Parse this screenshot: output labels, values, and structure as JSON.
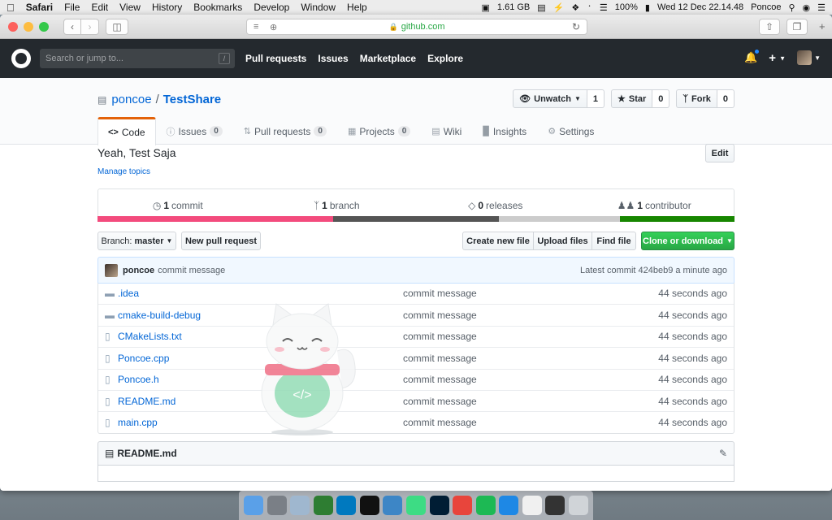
{
  "menubar": {
    "app": "Safari",
    "items": [
      "File",
      "Edit",
      "View",
      "History",
      "Bookmarks",
      "Develop",
      "Window",
      "Help"
    ],
    "memory": "1.61 GB",
    "battery": "100%",
    "datetime": "Wed 12 Dec  22.14.48",
    "user": "Poncoe"
  },
  "browser": {
    "url": "github.com"
  },
  "gh": {
    "search_placeholder": "Search or jump to...",
    "search_key": "/",
    "nav": [
      "Pull requests",
      "Issues",
      "Marketplace",
      "Explore"
    ]
  },
  "repo": {
    "owner": "poncoe",
    "separator": "/",
    "name": "TestShare",
    "watch_label": "Unwatch",
    "watch_count": "1",
    "star_label": "Star",
    "star_count": "0",
    "fork_label": "Fork",
    "fork_count": "0",
    "tabs": [
      {
        "label": "Code",
        "count": null
      },
      {
        "label": "Issues",
        "count": "0"
      },
      {
        "label": "Pull requests",
        "count": "0"
      },
      {
        "label": "Projects",
        "count": "0"
      },
      {
        "label": "Wiki",
        "count": null
      },
      {
        "label": "Insights",
        "count": null
      },
      {
        "label": "Settings",
        "count": null
      }
    ],
    "description": "Yeah, Test Saja",
    "manage_topics": "Manage topics",
    "edit_label": "Edit"
  },
  "summary": {
    "commits_num": "1",
    "commits_label": "commit",
    "branches_num": "1",
    "branches_label": "branch",
    "releases_num": "0",
    "releases_label": "releases",
    "contributors_num": "1",
    "contributors_label": "contributor"
  },
  "langbar_colors": [
    "#f34b7d",
    "#555555",
    "#cccccc",
    "#178600"
  ],
  "actions": {
    "branch_prefix": "Branch:",
    "branch_name": "master",
    "new_pr": "New pull request",
    "create_file": "Create new file",
    "upload": "Upload files",
    "find": "Find file",
    "clone": "Clone or download"
  },
  "commit": {
    "author": "poncoe",
    "message": "commit message",
    "latest": "Latest commit 424beb9 a minute ago"
  },
  "files": [
    {
      "type": "dir",
      "name": ".idea",
      "message": "commit message",
      "age": "44 seconds ago"
    },
    {
      "type": "dir",
      "name": "cmake-build-debug",
      "message": "commit message",
      "age": "44 seconds ago"
    },
    {
      "type": "file",
      "name": "CMakeLists.txt",
      "message": "commit message",
      "age": "44 seconds ago"
    },
    {
      "type": "file",
      "name": "Poncoe.cpp",
      "message": "commit message",
      "age": "44 seconds ago"
    },
    {
      "type": "file",
      "name": "Poncoe.h",
      "message": "commit message",
      "age": "44 seconds ago"
    },
    {
      "type": "file",
      "name": "README.md",
      "message": "commit message",
      "age": "44 seconds ago"
    },
    {
      "type": "file",
      "name": "main.cpp",
      "message": "commit message",
      "age": "44 seconds ago"
    }
  ],
  "readme": {
    "title": "README.md"
  },
  "cat_code_glyph": "</>"
}
